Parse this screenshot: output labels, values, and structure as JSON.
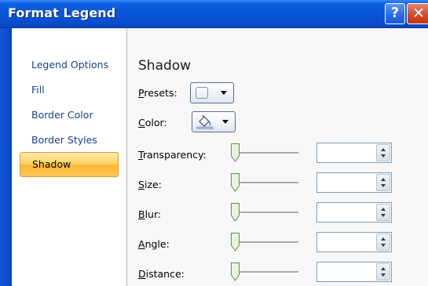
{
  "window": {
    "title": "Format Legend",
    "help_glyph": "?",
    "close_glyph": "✕"
  },
  "nav": {
    "items": [
      {
        "label": "Legend Options",
        "selected": false
      },
      {
        "label": "Fill",
        "selected": false
      },
      {
        "label": "Border Color",
        "selected": false
      },
      {
        "label": "Border Styles",
        "selected": false
      },
      {
        "label": "Shadow",
        "selected": true
      }
    ]
  },
  "panel": {
    "title": "Shadow",
    "presets": {
      "mnemonic": "P",
      "rest": "resets:"
    },
    "color": {
      "mnemonic": "C",
      "rest": "olor:"
    },
    "rows": [
      {
        "mnemonic": "T",
        "rest": "ransparency:",
        "slider_level": 0,
        "value": ""
      },
      {
        "mnemonic": "S",
        "rest": "ize:",
        "slider_level": 0,
        "value": ""
      },
      {
        "mnemonic": "B",
        "rest": "lur:",
        "slider_level": 0,
        "value": ""
      },
      {
        "mnemonic": "A",
        "rest": "ngle:",
        "slider_level": 0,
        "value": ""
      },
      {
        "mnemonic": "D",
        "rest": "istance:",
        "slider_level": 0,
        "value": ""
      }
    ]
  },
  "icons": {
    "help": "help-icon",
    "close": "close-icon",
    "preset": "shadow-preset-icon",
    "color": "paint-bucket-icon",
    "dropdown": "dropdown-arrow-icon",
    "spin": "spin-arrows-icon"
  },
  "colors": {
    "titlebar": "#0a55d8",
    "nav_text": "#15428b",
    "selected_bg": "#ffc85a",
    "close": "#d54a28"
  }
}
